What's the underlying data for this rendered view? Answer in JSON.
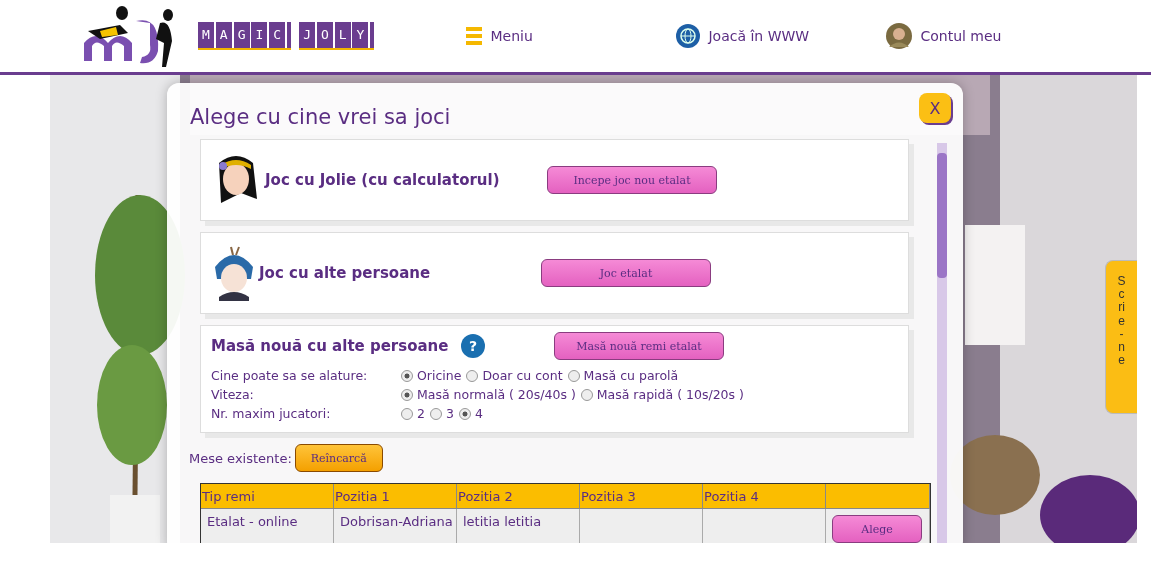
{
  "header": {
    "logo_words": [
      "MAGIC",
      "JOLY"
    ],
    "nav": [
      {
        "kind": "menu",
        "label": "Meniu"
      },
      {
        "kind": "globe",
        "label": "Joacă în WWW"
      },
      {
        "kind": "avatar",
        "label": "Contul meu"
      }
    ]
  },
  "dialog": {
    "title": "Alege cu cine vrei sa joci",
    "close": "X",
    "options": [
      {
        "kind": "girl",
        "label": "Joc cu Jolie (cu calculatorul)",
        "button": "Incepe joc nou etalat"
      },
      {
        "kind": "boy",
        "label": "Joc cu alte persoane",
        "button": "Joc etalat"
      }
    ],
    "new_table": {
      "title": "Masă nouă cu alte persoane",
      "help": "?",
      "button": "Masă nouă remi etalat",
      "settings": [
        {
          "label": "Cine poate sa se alature:",
          "options": [
            {
              "label": "Oricine",
              "selected": true
            },
            {
              "label": "Doar cu cont",
              "selected": false
            },
            {
              "label": "Masă cu parolă",
              "selected": false
            }
          ]
        },
        {
          "label": "Viteza:",
          "options": [
            {
              "label": "Masă normală ( 20s/40s )",
              "selected": true
            },
            {
              "label": "Masă rapidă ( 10s/20s )",
              "selected": false
            }
          ]
        },
        {
          "label": "Nr. maxim jucatori:",
          "options": [
            {
              "label": "2",
              "selected": false
            },
            {
              "label": "3",
              "selected": false
            },
            {
              "label": "4",
              "selected": true
            }
          ]
        }
      ]
    },
    "existing": {
      "label": "Mese existente:",
      "reload": "Reîncarcă",
      "columns": [
        "Tip remi",
        "Pozitia 1",
        "Pozitia 2",
        "Pozitia 3",
        "Pozitia 4"
      ],
      "rows": [
        {
          "cells": [
            "Etalat - online",
            "Dobrisan-Adriana",
            "letitia letitia",
            "",
            ""
          ],
          "button": "Alege"
        }
      ]
    }
  },
  "side_tab": "Scrie-ne"
}
